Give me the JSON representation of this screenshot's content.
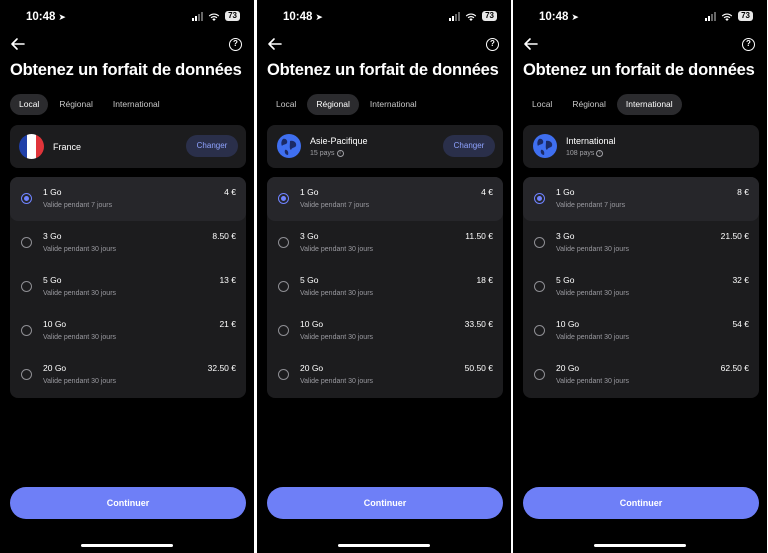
{
  "screens": [
    {
      "status": {
        "time": "10:48",
        "battery": "73"
      },
      "title": "Obtenez un forfait de données",
      "tabs": [
        {
          "label": "Local",
          "active": true
        },
        {
          "label": "Régional",
          "active": false
        },
        {
          "label": "International",
          "active": false
        }
      ],
      "region": {
        "name": "France",
        "sub": "",
        "icon": "france-flag",
        "change_label": "Changer"
      },
      "plans": [
        {
          "name": "1 Go",
          "desc": "Valide pendant 7 jours",
          "price": "4 €",
          "selected": true
        },
        {
          "name": "3 Go",
          "desc": "Valide pendant 30 jours",
          "price": "8.50 €",
          "selected": false
        },
        {
          "name": "5 Go",
          "desc": "Valide pendant 30 jours",
          "price": "13 €",
          "selected": false
        },
        {
          "name": "10 Go",
          "desc": "Valide pendant 30 jours",
          "price": "21 €",
          "selected": false
        },
        {
          "name": "20 Go",
          "desc": "Valide pendant 30 jours",
          "price": "32.50 €",
          "selected": false
        }
      ],
      "continue_label": "Continuer"
    },
    {
      "status": {
        "time": "10:48",
        "battery": "73"
      },
      "title": "Obtenez un forfait de données",
      "tabs": [
        {
          "label": "Local",
          "active": false
        },
        {
          "label": "Régional",
          "active": true
        },
        {
          "label": "International",
          "active": false
        }
      ],
      "region": {
        "name": "Asie-Pacifique",
        "sub": "15 pays",
        "icon": "asia-globe-icon",
        "change_label": "Changer"
      },
      "plans": [
        {
          "name": "1 Go",
          "desc": "Valide pendant 7 jours",
          "price": "4 €",
          "selected": true
        },
        {
          "name": "3 Go",
          "desc": "Valide pendant 30 jours",
          "price": "11.50 €",
          "selected": false
        },
        {
          "name": "5 Go",
          "desc": "Valide pendant 30 jours",
          "price": "18 €",
          "selected": false
        },
        {
          "name": "10 Go",
          "desc": "Valide pendant 30 jours",
          "price": "33.50 €",
          "selected": false
        },
        {
          "name": "20 Go",
          "desc": "Valide pendant 30 jours",
          "price": "50.50 €",
          "selected": false
        }
      ],
      "continue_label": "Continuer"
    },
    {
      "status": {
        "time": "10:48",
        "battery": "73"
      },
      "title": "Obtenez un forfait de données",
      "tabs": [
        {
          "label": "Local",
          "active": false
        },
        {
          "label": "Régional",
          "active": false
        },
        {
          "label": "International",
          "active": true
        }
      ],
      "region": {
        "name": "International",
        "sub": "108 pays",
        "icon": "world-globe-icon",
        "change_label": ""
      },
      "plans": [
        {
          "name": "1 Go",
          "desc": "Valide pendant 7 jours",
          "price": "8 €",
          "selected": true
        },
        {
          "name": "3 Go",
          "desc": "Valide pendant 30 jours",
          "price": "21.50 €",
          "selected": false
        },
        {
          "name": "5 Go",
          "desc": "Valide pendant 30 jours",
          "price": "32 €",
          "selected": false
        },
        {
          "name": "10 Go",
          "desc": "Valide pendant 30 jours",
          "price": "54 €",
          "selected": false
        },
        {
          "name": "20 Go",
          "desc": "Valide pendant 30 jours",
          "price": "62.50 €",
          "selected": false
        }
      ],
      "continue_label": "Continuer"
    }
  ],
  "colors": {
    "accent": "#6e7ff7",
    "card": "#1c1c1e",
    "background": "#000000"
  }
}
